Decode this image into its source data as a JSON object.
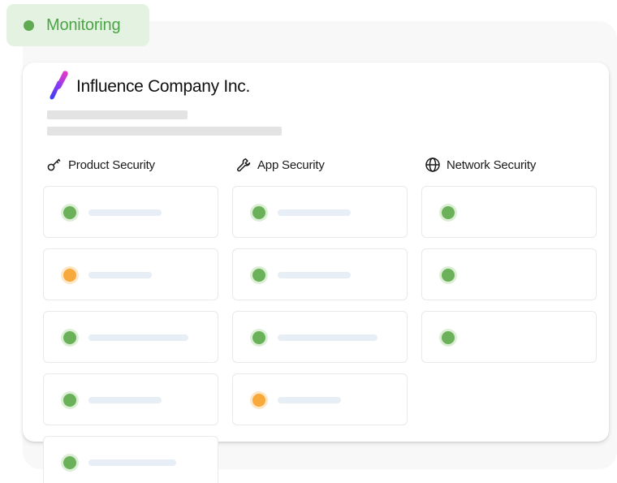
{
  "badge": {
    "label": "Monitoring",
    "color": "#4ba445",
    "background": "#e4f3e1"
  },
  "company": {
    "name": "Influence Company Inc.",
    "logo": "gradient-s-logo"
  },
  "columns": [
    {
      "label": "Product Security",
      "icon": "key-icon"
    },
    {
      "label": "App Security",
      "icon": "wrench-icon"
    },
    {
      "label": "Network Security",
      "icon": "globe-icon"
    }
  ],
  "status_colors": {
    "ok": "#6ab159",
    "warning": "#f7a93c"
  },
  "checks": {
    "product_security": [
      "ok",
      "warning",
      "ok",
      "ok",
      "ok"
    ],
    "app_security": [
      "ok",
      "ok",
      "ok",
      "warning"
    ],
    "network_security": [
      "ok",
      "ok",
      "ok"
    ]
  }
}
